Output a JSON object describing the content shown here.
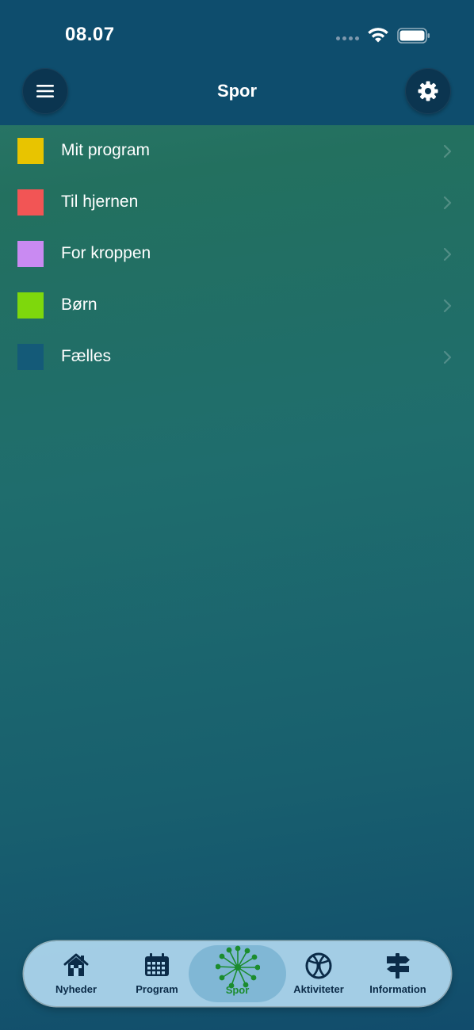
{
  "status_bar": {
    "time": "08.07"
  },
  "header": {
    "title": "Spor",
    "menu_icon": "hamburger-icon",
    "settings_icon": "gear-icon"
  },
  "list": {
    "items": [
      {
        "label": "Mit program",
        "color": "#e8c400"
      },
      {
        "label": "Til hjernen",
        "color": "#f25555"
      },
      {
        "label": "For kroppen",
        "color": "#c98af2"
      },
      {
        "label": "Børn",
        "color": "#7ed80c"
      },
      {
        "label": "Fælles",
        "color": "#145a78"
      }
    ]
  },
  "tab_bar": {
    "tabs": [
      {
        "label": "Nyheder",
        "icon": "house-icon",
        "active": false
      },
      {
        "label": "Program",
        "icon": "calendar-icon",
        "active": false
      },
      {
        "label": "Spor",
        "icon": "dandelion-icon",
        "active": true
      },
      {
        "label": "Aktiviteter",
        "icon": "basketball-icon",
        "active": false
      },
      {
        "label": "Information",
        "icon": "signpost-icon",
        "active": false
      }
    ]
  },
  "colors": {
    "header_bg": "#0e4d6d",
    "active_tab_accent": "#1b8c2e",
    "tab_icon": "#0b2b48"
  }
}
